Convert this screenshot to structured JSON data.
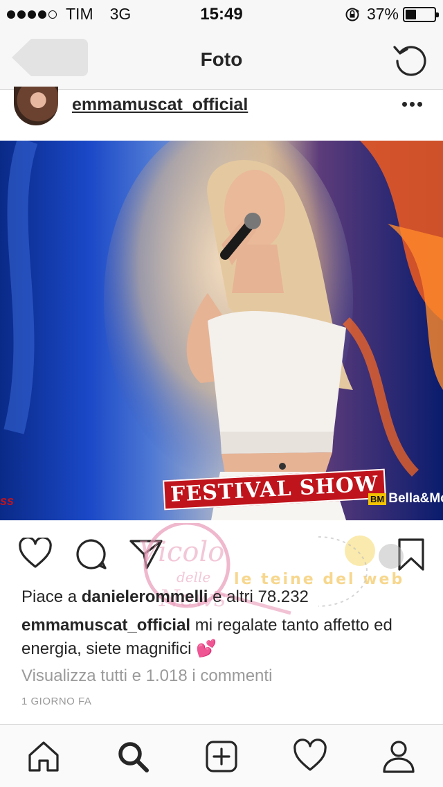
{
  "status_bar": {
    "signal_strength": 4,
    "signal_max": 5,
    "carrier": "TIM",
    "network": "3G",
    "time": "15:49",
    "battery_percent": "37%",
    "battery_level": 0.37
  },
  "nav": {
    "title": "Foto",
    "back_icon": "back-arrow-icon",
    "refresh_icon": "refresh-icon"
  },
  "post": {
    "username": "emmamuscat_official",
    "photo_logo_text": "FESTIVAL SHOW",
    "photo_brand_badge": "BM",
    "photo_brand_text": "Bella&Mo",
    "photo_left_edge_text": "ss",
    "likes_prefix": "Piace a",
    "likes_user": "danielerommelli",
    "likes_suffix": "e altri 78.232",
    "caption_user": "emmamuscat_official",
    "caption_text": "mi regalate tanto affetto ed energia, siete magnifici",
    "caption_emoji": "💕",
    "view_comments": "Visualizza tutti e 1.018 i commenti",
    "timestamp": "1 GIORNO FA"
  },
  "watermark": {
    "text_top": "Vicolo",
    "text_mid": "delle",
    "text_bottom": "News",
    "text_right": "le teine del web"
  },
  "tabs": [
    {
      "name": "home",
      "icon": "home-icon"
    },
    {
      "name": "search",
      "icon": "search-icon"
    },
    {
      "name": "add",
      "icon": "add-icon"
    },
    {
      "name": "activity",
      "icon": "heart-icon"
    },
    {
      "name": "profile",
      "icon": "profile-icon"
    }
  ],
  "colors": {
    "text": "#262626",
    "muted": "#9a9a9a",
    "bar_bg": "#f7f7f7",
    "emoji_pink": "#e8468f"
  }
}
